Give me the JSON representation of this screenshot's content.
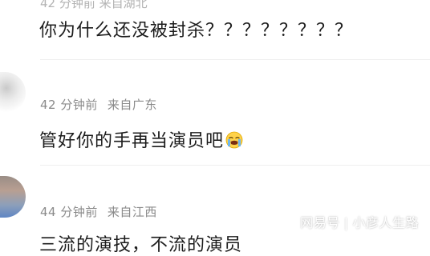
{
  "comments": [
    {
      "meta_partial": "42 分钟前  来自湖北",
      "content": "你为什么还没被封杀？？？？？？？？"
    },
    {
      "time": "42 分钟前",
      "location": "来自广东",
      "content": "管好你的手再当演员吧",
      "emoji": "crying-face-emoji"
    },
    {
      "time": "44 分钟前",
      "location": "来自江西",
      "content": "三流的演技，不流的演员"
    }
  ],
  "watermark": {
    "brand": "网易号",
    "separator": "|",
    "author": "小彦人生路"
  },
  "colors": {
    "meta_text": "#8a8a8a",
    "content_text": "#1c1c1c",
    "background": "#ffffff"
  }
}
